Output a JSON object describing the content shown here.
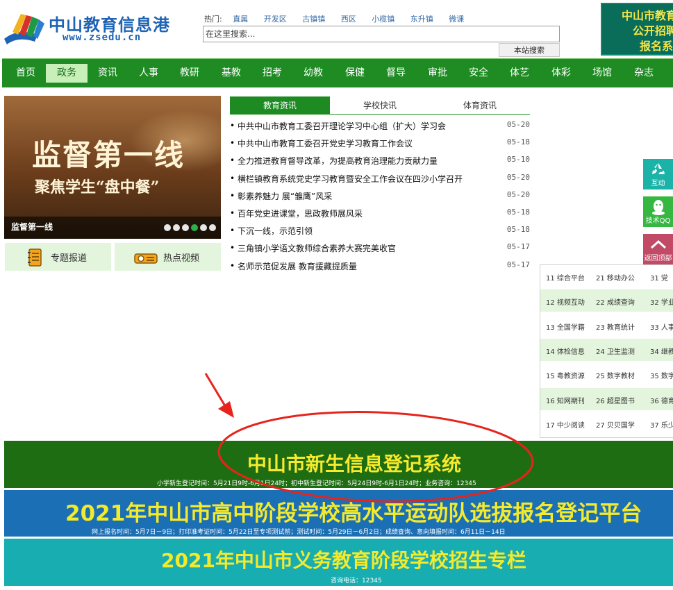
{
  "header": {
    "logo_title": "中山教育信息港",
    "logo_url": "www.zsedu.cn",
    "hot_label": "热门:",
    "hot_links": [
      "直属",
      "开发区",
      "古镇镇",
      "西区",
      "小榄镇",
      "东升镇",
      "微课"
    ],
    "search_placeholder": "在这里搜索...",
    "search_button": "本站搜索",
    "ad_lines": [
      "中山市教育",
      "公开招聘",
      "报名系统"
    ]
  },
  "nav": {
    "items": [
      "首页",
      "政务",
      "资讯",
      "人事",
      "教研",
      "基教",
      "招考",
      "幼教",
      "保健",
      "督导",
      "审批",
      "安全",
      "体艺",
      "体彩",
      "场馆",
      "杂志"
    ],
    "active": "政务"
  },
  "slider": {
    "title": "监督第一线",
    "subtitle": "聚焦学生“盘中餐”",
    "caption": "监督第一线",
    "dot_count": 6,
    "active_dot": 4
  },
  "quick_buttons": [
    "专题报道",
    "热点视频"
  ],
  "tabs": [
    "教育资讯",
    "学校快讯",
    "体育资讯"
  ],
  "news": [
    {
      "title": "中共中山市教育工委召开理论学习中心组（扩大）学习会",
      "date": "05-20"
    },
    {
      "title": "中共中山市教育工委召开党史学习教育工作会议",
      "date": "05-18"
    },
    {
      "title": "全力推进教育督导改革，为提高教育治理能力贡献力量",
      "date": "05-10"
    },
    {
      "title": "横栏镇教育系统党史学习教育暨安全工作会议在四沙小学召开",
      "date": "05-20"
    },
    {
      "title": "彰素养魅力 展“雏鹰”风采",
      "date": "05-20"
    },
    {
      "title": "百年党史进课堂，思政教师展风采",
      "date": "05-18"
    },
    {
      "title": "下沉一线，示范引领",
      "date": "05-18"
    },
    {
      "title": "三角镇小学语文教师综合素养大赛完美收官",
      "date": "05-17"
    },
    {
      "title": "名师示范促发展 教育援藏提质量",
      "date": "05-17"
    }
  ],
  "side_buttons": {
    "interact": "互动",
    "qq": "技术QQ",
    "back_top": "返回顶部"
  },
  "platform_rows": [
    [
      "11 综合平台",
      "21 移动办公",
      "31 党"
    ],
    [
      "12 视频互动",
      "22 成绩查询",
      "32 学业"
    ],
    [
      "13 全国学籍",
      "23 教育统计",
      "33 人事"
    ],
    [
      "14 体检信息",
      "24 卫生监测",
      "34 继教"
    ],
    [
      "15 粤教资源",
      "25 数字教材",
      "35 数字"
    ],
    [
      "16 知网期刊",
      "26 超星图书",
      "36 德育"
    ],
    [
      "17 中少阅读",
      "27 贝贝国学",
      "37 乐少"
    ]
  ],
  "banners": [
    {
      "title": "中山市新生信息登记系统",
      "sub": "小学新生登记时间：5月21日9时-6月1日24时；初中新生登记时间：5月24日9时-6月1日24时；业务咨询：12345"
    },
    {
      "title": "2021年中山市高中阶段学校高水平运动队选拔报名登记平台",
      "sub": "网上报名时间：5月7日－9日；打印准考证时间：5月22日至专项测试前；测试时间：5月29日－6月2日；成绩查询、意向填报时间：6月11日－14日"
    },
    {
      "title": "2021年中山市义务教育阶段学校招生专栏",
      "sub": "咨询电话：12345"
    }
  ],
  "colors": {
    "nav_green": "#1f8c23",
    "annotation_red": "#e8231c",
    "banner_yellow": "#f4ea2c"
  }
}
